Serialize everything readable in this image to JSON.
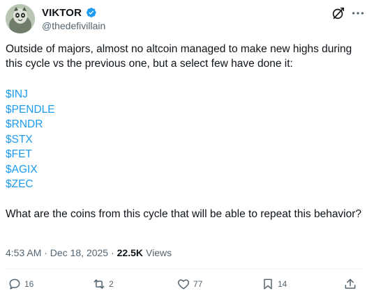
{
  "author": {
    "display_name": "VIKTOR",
    "handle": "@thedefivillain"
  },
  "tweet": {
    "text": "Outside of majors, almost no altcoin managed to make new highs during this cycle vs the previous one, but a select few have done it:",
    "tickers": [
      "$INJ",
      "$PENDLE",
      "$RNDR",
      "$STX",
      "$FET",
      "$AGIX",
      "$ZEC"
    ],
    "question": "What are the coins from this cycle that will be able to repeat this behavior?"
  },
  "meta": {
    "timestamp": "4:53 AM · Dec 18, 2025 ·",
    "views_count": "22.5K",
    "views_label": "Views"
  },
  "actions": {
    "replies": "16",
    "reposts": "2",
    "likes": "77",
    "bookmarks": "14"
  },
  "colors": {
    "accent": "#1d9bf0",
    "text_primary": "#0f1419",
    "text_secondary": "#536471"
  }
}
